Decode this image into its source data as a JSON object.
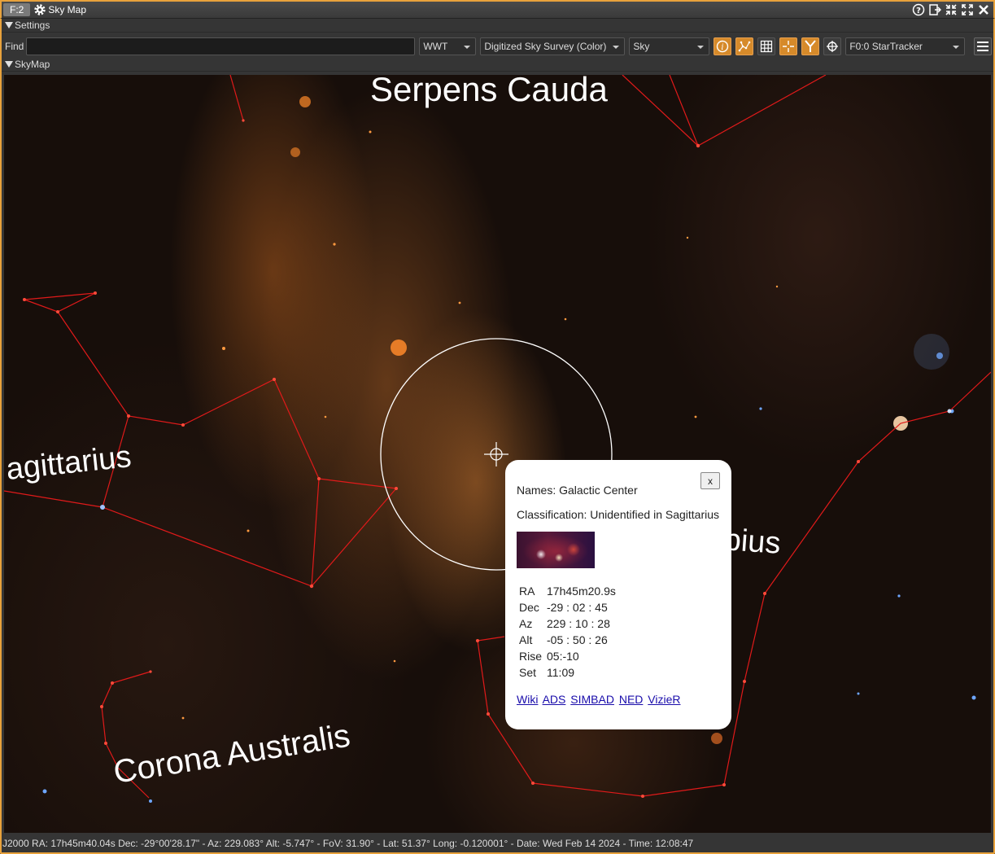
{
  "window": {
    "badge": "F:2",
    "title": "Sky Map"
  },
  "sections": {
    "settings": "Settings",
    "skymap": "SkyMap"
  },
  "settings": {
    "find_label": "Find",
    "find_value": "",
    "backend": "WWT",
    "survey": "Digitized Sky Survey (Color)",
    "projection": "Sky",
    "source": "F0:0 StarTracker"
  },
  "map": {
    "labels": {
      "serpens": "Serpens Cauda",
      "sagittarius": "agittarius",
      "scorpius": "pius",
      "corona": "Corona Australis"
    }
  },
  "popup": {
    "close": "x",
    "names": "Names: Galactic Center",
    "classification": "Classification: Unidentified in Sagittarius",
    "rows": [
      {
        "key": "RA",
        "value": "17h45m20.9s"
      },
      {
        "key": "Dec",
        "value": "-29 : 02 : 45"
      },
      {
        "key": "Az",
        "value": "229 : 10 : 28"
      },
      {
        "key": "Alt",
        "value": "-05 : 50 : 26"
      },
      {
        "key": "Rise",
        "value": "05:-10"
      },
      {
        "key": "Set",
        "value": "11:09"
      }
    ],
    "links": [
      "Wiki",
      "ADS",
      "SIMBAD",
      "NED",
      "VizieR"
    ]
  },
  "status": {
    "text": "J2000  RA: 17h45m40.04s  Dec: -29°00'28.17\" - Az: 229.083°  Alt: -5.747° - FoV: 31.90° - Lat: 51.37° Long: -0.120001° - Date: Wed Feb 14 2024 - Time: 12:08:47"
  },
  "colors": {
    "accent": "#e8a23c",
    "constellation_lines": "#e01a1a",
    "toggle_on": "#d68a2a"
  }
}
